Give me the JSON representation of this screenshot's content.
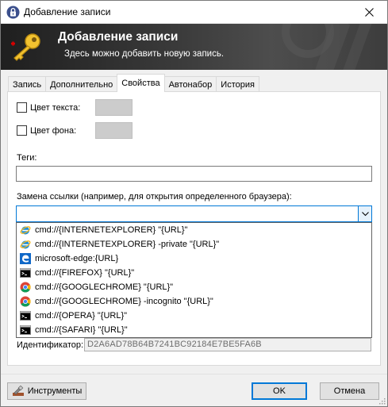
{
  "window": {
    "title": "Добавление записи"
  },
  "banner": {
    "title": "Добавление записи",
    "subtitle": "Здесь можно добавить новую запись."
  },
  "tabs": [
    {
      "label": "Запись",
      "active": false
    },
    {
      "label": "Дополнительно",
      "active": false
    },
    {
      "label": "Свойства",
      "active": true
    },
    {
      "label": "Автонабор",
      "active": false
    },
    {
      "label": "История",
      "active": false
    }
  ],
  "properties": {
    "text_color_label": "Цвет текста:",
    "text_color_checked": false,
    "bg_color_label": "Цвет фона:",
    "bg_color_checked": false,
    "swatch_color": "#cccccc",
    "tags_label": "Теги:",
    "tags_value": "",
    "url_override_label": "Замена ссылки (например, для открытия определенного браузера):",
    "url_override_value": "",
    "id_label": "Идентификатор:",
    "id_value": "D2A6AD78B64B7241BC92184E7BE5FA6B"
  },
  "dropdown": {
    "items": [
      {
        "text": "cmd://{INTERNETEXPLORER} \"{URL}\"",
        "icon": "internet-explorer-icon"
      },
      {
        "text": "cmd://{INTERNETEXPLORER} -private \"{URL}\"",
        "icon": "internet-explorer-icon"
      },
      {
        "text": "microsoft-edge:{URL}",
        "icon": "edge-icon"
      },
      {
        "text": "cmd://{FIREFOX} \"{URL}\"",
        "icon": "console-icon"
      },
      {
        "text": "cmd://{GOOGLECHROME} \"{URL}\"",
        "icon": "chrome-icon"
      },
      {
        "text": "cmd://{GOOGLECHROME} -incognito \"{URL}\"",
        "icon": "chrome-icon"
      },
      {
        "text": "cmd://{OPERA} \"{URL}\"",
        "icon": "console-icon"
      },
      {
        "text": "cmd://{SAFARI} \"{URL}\"",
        "icon": "console-icon"
      }
    ]
  },
  "buttons": {
    "tools": "Инструменты",
    "ok": "OK",
    "cancel": "Отмена"
  },
  "colors": {
    "accent": "#0078d7",
    "banner_dark": "#1f1f1f"
  }
}
